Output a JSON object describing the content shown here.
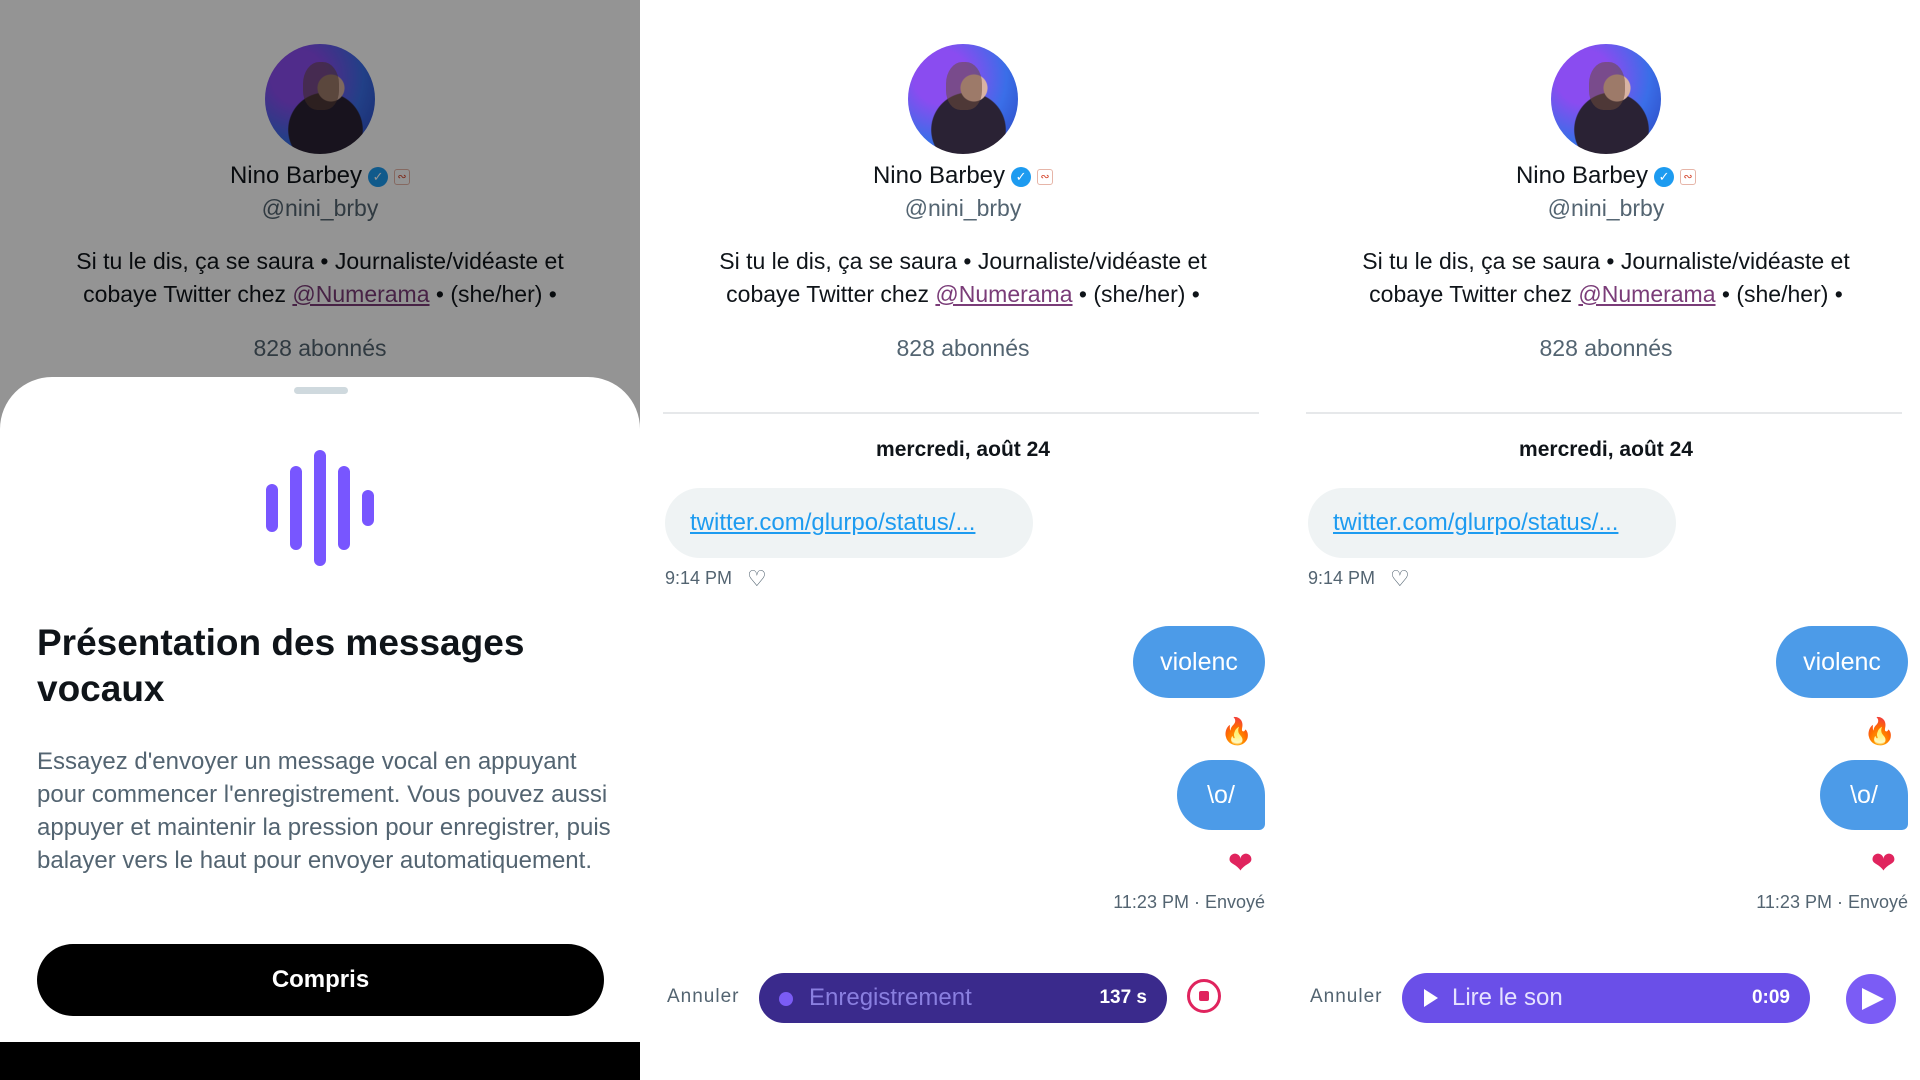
{
  "profile": {
    "name": "Nino Barbey",
    "handle": "@nini_brby",
    "bio_part1": "Si tu le dis, ça se saura • Journaliste/vidéaste et cobaye Twitter chez ",
    "bio_mention": "@Numerama",
    "bio_part2": " • (she/her) •",
    "followers": "828 abonnés"
  },
  "conversation": {
    "date": "mercredi, août 24",
    "incoming_link": "twitter.com/glurpo/status/...",
    "incoming_time": "9:14 PM",
    "outgoing_1": "violenc",
    "reaction_1": "🔥",
    "outgoing_2": "\\o/",
    "reaction_2": "❤",
    "sent_status": "11:23 PM · Envoyé"
  },
  "sheet": {
    "title": "Présentation des messages vocaux",
    "body": "Essayez d'envoyer un message vocal en appuyant pour commencer l'enregistrement. Vous pouvez aussi appuyer et maintenir la pression pour enregistrer, puis balayer vers le haut pour envoyer automatiquement.",
    "button": "Compris"
  },
  "composer_recording": {
    "cancel": "Annuler",
    "label": "Enregistrement",
    "count": "137 s"
  },
  "composer_playback": {
    "cancel": "Annuler",
    "label": "Lire le son",
    "count": "0:09"
  },
  "icons": {
    "verified": "verified-badge-icon",
    "affiliate": "affiliation-icon",
    "add_reaction": "heart-plus-icon",
    "record": "record-dot-icon",
    "stop": "stop-icon",
    "play": "play-icon",
    "send": "send-icon",
    "voice": "voice-wave-icon"
  },
  "colors": {
    "accent": "#1d9bf0",
    "bubble_out": "#4c9be8",
    "voice_purple": "#7856ff",
    "recording_pill": "#3a2a8c",
    "stop_red": "#e0245e"
  }
}
